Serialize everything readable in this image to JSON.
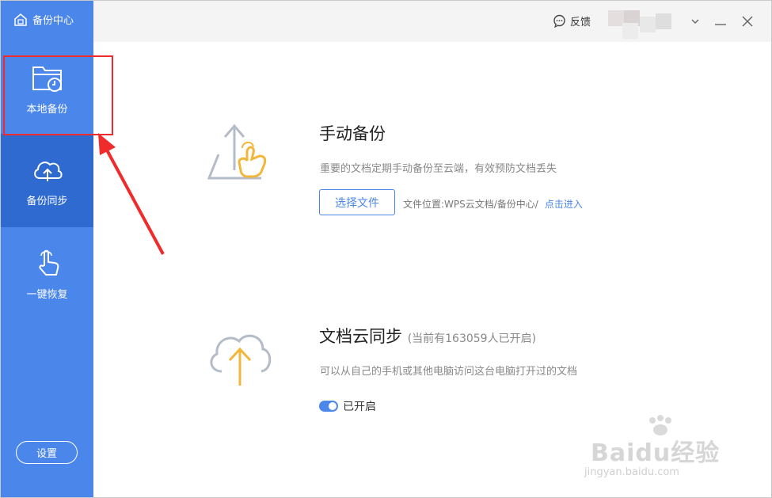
{
  "sidebar": {
    "brand_label": "备份中心",
    "items": [
      {
        "label": "本地备份"
      },
      {
        "label": "备份同步"
      },
      {
        "label": "一键恢复"
      }
    ],
    "settings_label": "设置",
    "bg_color": "#4b87eb",
    "active_color": "#2f6ad1"
  },
  "titlebar": {
    "feedback_label": "反馈"
  },
  "manual_backup": {
    "title": "手动备份",
    "desc": "重要的文档定期手动备份至云端，有效预防文档丢失",
    "choose_label": "选择文件",
    "location_label": "文件位置:WPS云文档/备份中心/",
    "enter_label": "点击进入"
  },
  "cloud_sync": {
    "title": "文档云同步",
    "subtitle": "(当前有163059人已开启)",
    "desc": "可以从自己的手机或其他电脑访问这台电脑打开过的文档",
    "toggle_label": "已开启",
    "toggle_on": true
  },
  "watermark": {
    "brand": "Baidu经验",
    "url": "jingyan.baidu.com"
  },
  "annotation": {
    "highlight_color": "#ef2b2b"
  }
}
